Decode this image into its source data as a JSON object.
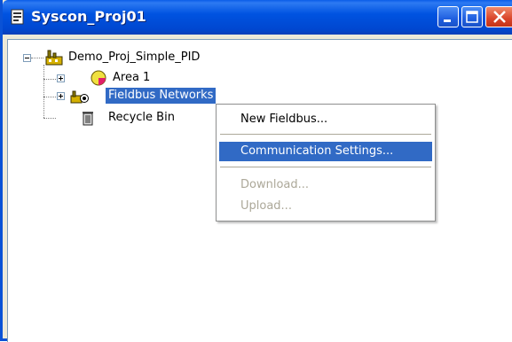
{
  "window": {
    "title": "Syscon_Proj01"
  },
  "tree": {
    "root": "Demo_Proj_Simple_PID",
    "items": [
      {
        "label": "Area 1"
      },
      {
        "label": "Fieldbus Networks"
      },
      {
        "label": "Recycle Bin"
      }
    ]
  },
  "context_menu": {
    "items": [
      {
        "label": "New Fieldbus..."
      },
      {
        "label": "Communication Settings..."
      },
      {
        "label": "Download..."
      },
      {
        "label": "Upload..."
      }
    ]
  },
  "icons": {
    "title": "project-icon",
    "root": "project-plant-icon",
    "area": "area-icon",
    "fieldbus": "fieldbus-network-icon",
    "recycle": "recycle-bin-icon"
  },
  "colors": {
    "selection": "#316ac5",
    "titlebar": "#0053e1",
    "disabled_text": "#aca899"
  }
}
